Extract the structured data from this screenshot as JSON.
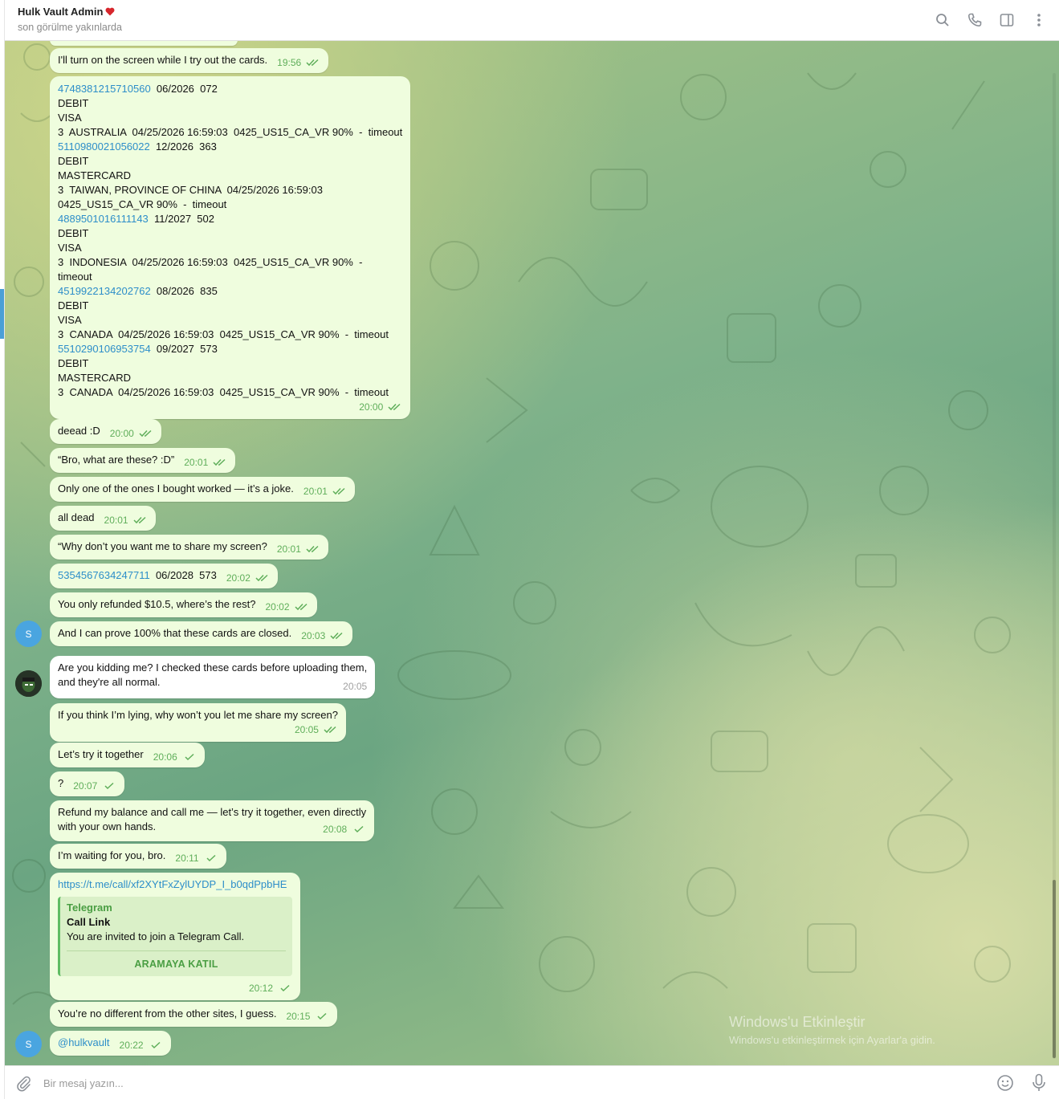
{
  "header": {
    "title": "Hulk Vault Admin",
    "subtitle": "son görülme yakınlarda",
    "icons": [
      "search-icon",
      "phone-icon",
      "sidebar-toggle-icon",
      "more-vertical-icon"
    ]
  },
  "colors": {
    "outgoing_bubble": "#effdde",
    "incoming_bubble": "#ffffff",
    "link": "#2d8ec9",
    "check": "#5fae5a",
    "accent": "#4a9fd6"
  },
  "messages": {
    "m1": {
      "text": "I'll turn on the screen while I try out the cards.",
      "time": "19:56"
    },
    "m2": {
      "lines": [
        {
          "link": "4748381215710560",
          "rest": "  06/2026  072"
        },
        {
          "text": "DEBIT"
        },
        {
          "text": "VISA"
        },
        {
          "text": "3  AUSTRALIA  04/25/2026 16:59:03  0425_US15_CA_VR 90%  -  timeout"
        },
        {
          "link": "5110980021056022",
          "rest": "  12/2026  363"
        },
        {
          "text": "DEBIT"
        },
        {
          "text": "MASTERCARD"
        },
        {
          "text": "3  TAIWAN, PROVINCE OF CHINA  04/25/2026 16:59:03"
        },
        {
          "text": "0425_US15_CA_VR 90%  -  timeout"
        },
        {
          "link": "4889501016111143",
          "rest": "  11/2027  502"
        },
        {
          "text": "DEBIT"
        },
        {
          "text": "VISA"
        },
        {
          "text": "3  INDONESIA  04/25/2026 16:59:03  0425_US15_CA_VR 90%  -"
        },
        {
          "text": "timeout"
        },
        {
          "link": "4519922134202762",
          "rest": "  08/2026  835"
        },
        {
          "text": "DEBIT"
        },
        {
          "text": "VISA"
        },
        {
          "text": "3  CANADA  04/25/2026 16:59:03  0425_US15_CA_VR 90%  -  timeout"
        },
        {
          "link": "5510290106953754",
          "rest": "  09/2027  573"
        },
        {
          "text": "DEBIT"
        },
        {
          "text": "MASTERCARD"
        },
        {
          "text": "3  CANADA  04/25/2026 16:59:03  0425_US15_CA_VR 90%  -  timeout"
        }
      ],
      "time": "20:00"
    },
    "m3": {
      "text": "deead :D",
      "time": "20:00"
    },
    "m4": {
      "text": "“Bro, what are these? :D”",
      "time": "20:01"
    },
    "m5": {
      "text": "Only one of the ones I bought worked — it’s a joke.",
      "time": "20:01"
    },
    "m6": {
      "text": "all dead",
      "time": "20:01"
    },
    "m7": {
      "text": "“Why don’t you want me to share my screen?",
      "time": "20:01"
    },
    "m8": {
      "link": "5354567634247711",
      "rest": "  06/2028  573",
      "time": "20:02"
    },
    "m9": {
      "text": "You only refunded $10.5, where’s the rest?",
      "time": "20:02"
    },
    "m10": {
      "text": "And I can prove 100% that these cards are closed.",
      "time": "20:03",
      "avatar": "S"
    },
    "m11": {
      "line1": "Are you kidding me? I checked these cards before uploading them,",
      "line2": "and they're all normal.",
      "time": "20:05"
    },
    "m12": {
      "text": "If you think I’m lying, why won’t you let me share my screen?",
      "time": "20:05"
    },
    "m13": {
      "text": "Let’s try it together",
      "time": "20:06"
    },
    "m14": {
      "text": "?",
      "time": "20:07"
    },
    "m15": {
      "line1": "Refund my balance and call me — let’s try it together, even directly",
      "line2": "with your own hands.",
      "time": "20:08"
    },
    "m16": {
      "text": "I’m waiting for you, bro.",
      "time": "20:11"
    },
    "m17": {
      "link": "https://t.me/call/xf2XYtFxZylUYDP_I_b0qdPpbHE",
      "preview_site": "Telegram",
      "preview_title": "Call Link",
      "preview_desc": "You are invited to join a Telegram Call.",
      "preview_button": "ARAMAYA KATIL",
      "time": "20:12"
    },
    "m18": {
      "text": "You’re no different from the other sites, I guess.",
      "time": "20:15"
    },
    "m19": {
      "text": "@hulkvault",
      "time": "20:22",
      "avatar": "S"
    }
  },
  "watermark": {
    "title": "Windows'u Etkinleştir",
    "subtitle": "Windows'u etkinleştirmek için Ayarlar'a gidin."
  },
  "composer": {
    "placeholder": "Bir mesaj yazın..."
  }
}
